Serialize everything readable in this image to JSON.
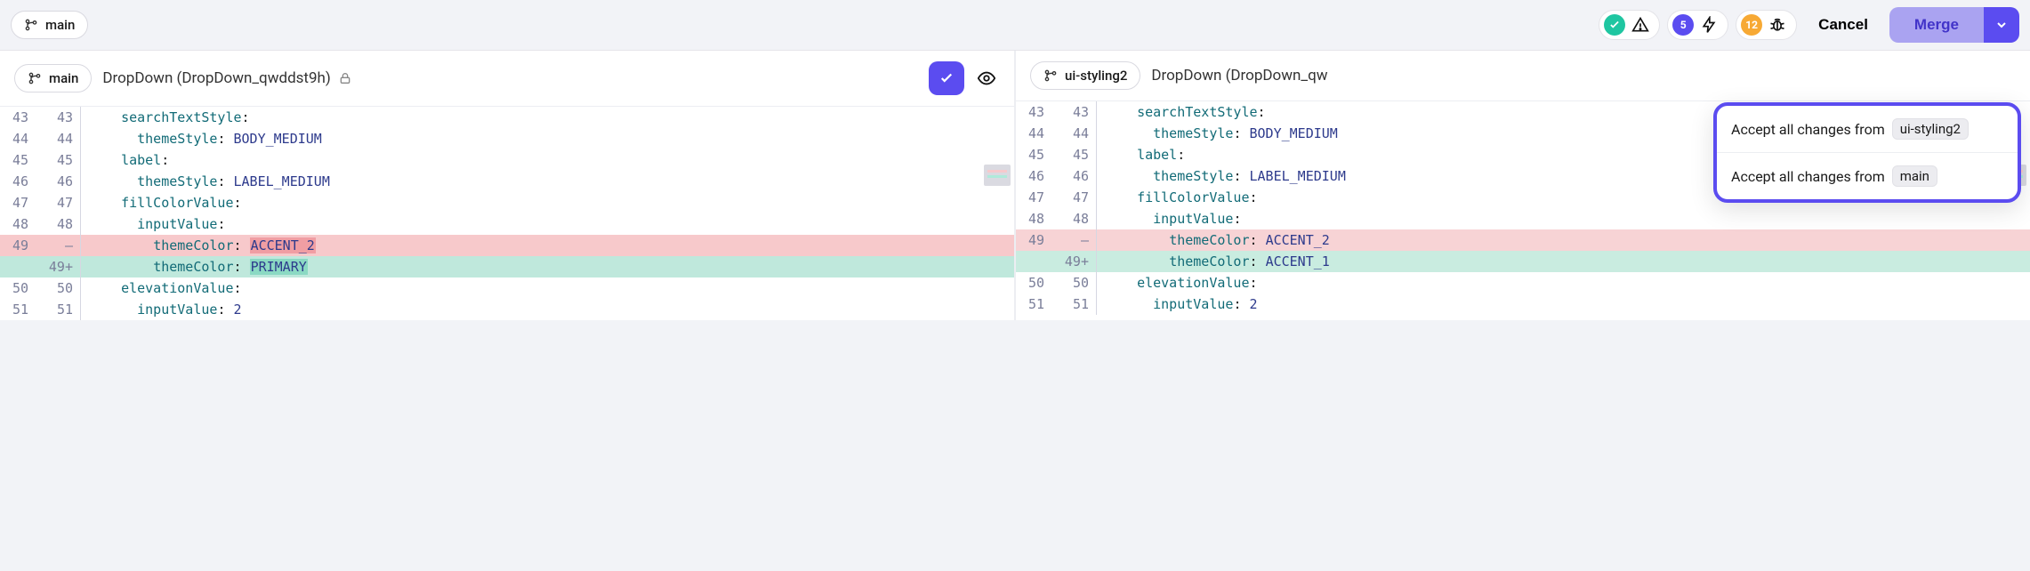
{
  "topbar": {
    "branch": "main",
    "cancel_label": "Cancel",
    "merge_label": "Merge",
    "status": {
      "warnings_badge": "5",
      "issues_badge": "12"
    }
  },
  "dropdown": {
    "prefix": "Accept all changes from",
    "option1_branch": "ui-styling2",
    "option2_branch": "main"
  },
  "panes": [
    {
      "branch": "main",
      "title": "DropDown (DropDown_qwddst9h)",
      "locked": true,
      "rows": [
        {
          "l": "43",
          "r": "43",
          "content": [
            [
              "k",
              "searchTextStyle"
            ],
            [
              "p",
              ":"
            ]
          ],
          "indent": 1
        },
        {
          "l": "44",
          "r": "44",
          "content": [
            [
              "k",
              "themeStyle"
            ],
            [
              "p",
              ": "
            ],
            [
              "v",
              "BODY_MEDIUM"
            ]
          ],
          "indent": 2
        },
        {
          "l": "45",
          "r": "45",
          "content": [
            [
              "k",
              "label"
            ],
            [
              "p",
              ":"
            ]
          ],
          "indent": 1
        },
        {
          "l": "46",
          "r": "46",
          "content": [
            [
              "k",
              "themeStyle"
            ],
            [
              "p",
              ": "
            ],
            [
              "v",
              "LABEL_MEDIUM"
            ]
          ],
          "indent": 2
        },
        {
          "l": "47",
          "r": "47",
          "content": [
            [
              "k",
              "fillColorValue"
            ],
            [
              "p",
              ":"
            ]
          ],
          "indent": 1
        },
        {
          "l": "48",
          "r": "48",
          "content": [
            [
              "k",
              "inputValue"
            ],
            [
              "p",
              ":"
            ]
          ],
          "indent": 2
        },
        {
          "l": "49",
          "r": "—",
          "type": "del",
          "content": [
            [
              "k",
              "themeColor"
            ],
            [
              "p",
              ": "
            ],
            [
              "mdel",
              "ACCENT_2"
            ]
          ],
          "indent": 3
        },
        {
          "l": "",
          "r": "49+",
          "type": "add",
          "content": [
            [
              "k",
              "themeColor"
            ],
            [
              "p",
              ": "
            ],
            [
              "madd",
              "PRIMARY"
            ]
          ],
          "indent": 3
        },
        {
          "l": "50",
          "r": "50",
          "content": [
            [
              "k",
              "elevationValue"
            ],
            [
              "p",
              ":"
            ]
          ],
          "indent": 1
        },
        {
          "l": "51",
          "r": "51",
          "content": [
            [
              "k",
              "inputValue"
            ],
            [
              "p",
              ": "
            ],
            [
              "v",
              "2"
            ]
          ],
          "indent": 2
        }
      ]
    },
    {
      "branch": "ui-styling2",
      "title": "DropDown (DropDown_qw",
      "locked": false,
      "rows": [
        {
          "l": "43",
          "r": "43",
          "content": [
            [
              "k",
              "searchTextStyle"
            ],
            [
              "p",
              ":"
            ]
          ],
          "indent": 1
        },
        {
          "l": "44",
          "r": "44",
          "content": [
            [
              "k",
              "themeStyle"
            ],
            [
              "p",
              ": "
            ],
            [
              "v",
              "BODY_MEDIUM"
            ]
          ],
          "indent": 2
        },
        {
          "l": "45",
          "r": "45",
          "content": [
            [
              "k",
              "label"
            ],
            [
              "p",
              ":"
            ]
          ],
          "indent": 1
        },
        {
          "l": "46",
          "r": "46",
          "content": [
            [
              "k",
              "themeStyle"
            ],
            [
              "p",
              ": "
            ],
            [
              "v",
              "LABEL_MEDIUM"
            ]
          ],
          "indent": 2
        },
        {
          "l": "47",
          "r": "47",
          "content": [
            [
              "k",
              "fillColorValue"
            ],
            [
              "p",
              ":"
            ]
          ],
          "indent": 1
        },
        {
          "l": "48",
          "r": "48",
          "content": [
            [
              "k",
              "inputValue"
            ],
            [
              "p",
              ":"
            ]
          ],
          "indent": 2
        },
        {
          "l": "49",
          "r": "—",
          "type": "del-light",
          "content": [
            [
              "k",
              "themeColor"
            ],
            [
              "p",
              ": "
            ],
            [
              "v",
              "ACCENT_2"
            ]
          ],
          "indent": 3
        },
        {
          "l": "",
          "r": "49+",
          "type": "add-light",
          "content": [
            [
              "k",
              "themeColor"
            ],
            [
              "p",
              ": "
            ],
            [
              "v",
              "ACCENT_1"
            ]
          ],
          "indent": 3
        },
        {
          "l": "50",
          "r": "50",
          "content": [
            [
              "k",
              "elevationValue"
            ],
            [
              "p",
              ":"
            ]
          ],
          "indent": 1
        },
        {
          "l": "51",
          "r": "51",
          "content": [
            [
              "k",
              "inputValue"
            ],
            [
              "p",
              ": "
            ],
            [
              "v",
              "2"
            ]
          ],
          "indent": 2
        }
      ]
    }
  ]
}
